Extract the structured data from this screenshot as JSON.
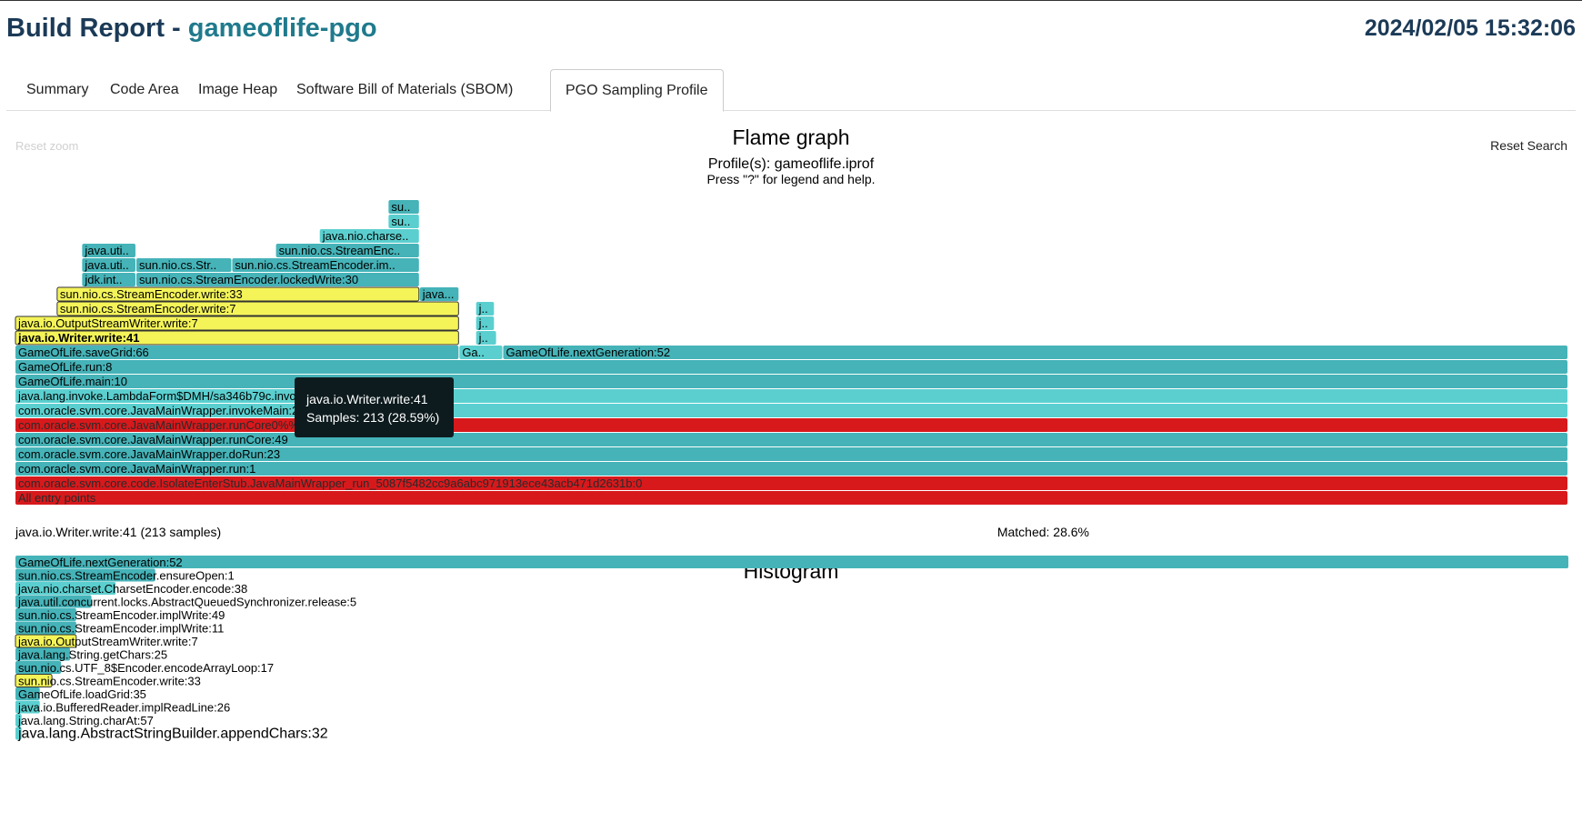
{
  "header": {
    "title_prefix": "Build Report - ",
    "project": "gameoflife-pgo",
    "datetime": "2024/02/05 15:32:06"
  },
  "tabs": [
    {
      "label": "Summary",
      "active": false
    },
    {
      "label": "Code Area",
      "active": false
    },
    {
      "label": "Image Heap",
      "active": false
    },
    {
      "label": "Software Bill of Materials (SBOM)",
      "active": false
    },
    {
      "label": "PGO Sampling Profile",
      "active": true
    }
  ],
  "flame": {
    "title": "Flame graph",
    "subtitle": "Profile(s): gameoflife.iprof",
    "help": "Press \"?\" for legend and help.",
    "reset_zoom": "Reset zoom",
    "reset_search": "Reset Search",
    "details": "java.io.Writer.write:41 (213 samples)",
    "matched": "Matched: 28.6%",
    "tooltip": {
      "name": "java.io.Writer.write:41",
      "samples": "Samples: 213 (28.59%)"
    }
  },
  "chart_data": {
    "type": "flame",
    "total_samples": 745,
    "frames": [
      {
        "name": "All entry points",
        "depth": 0,
        "start": 0,
        "samples": 745,
        "color": "#d7191c"
      },
      {
        "name": "com.oracle.svm.core.code.IsolateEnterStub.JavaMainWrapper_run_5087f5482cc9a6abc971913ece43acb471d2631b:0",
        "depth": 1,
        "start": 0,
        "samples": 745,
        "color": "#d7191c"
      },
      {
        "name": "com.oracle.svm.core.JavaMainWrapper.run:1",
        "depth": 2,
        "start": 0,
        "samples": 745,
        "color": "#45b3b8"
      },
      {
        "name": "com.oracle.svm.core.JavaMainWrapper.doRun:23",
        "depth": 3,
        "start": 0,
        "samples": 745,
        "color": "#45b3b8"
      },
      {
        "name": "com.oracle.svm.core.JavaMainWrapper.runCore:49",
        "depth": 4,
        "start": 0,
        "samples": 745,
        "color": "#45b3b8"
      },
      {
        "name": "com.oracle.svm.core.JavaMainWrapper.runCore0%%Host_Method_Key_0:0",
        "depth": 5,
        "start": 0,
        "samples": 745,
        "color": "#d7191c"
      },
      {
        "name": "com.oracle.svm.core.JavaMainWrapper.invokeMain:29",
        "depth": 6,
        "start": 0,
        "samples": 745,
        "color": "#5bcfcf"
      },
      {
        "name": "java.lang.invoke.LambdaForm$DMH/sa346b79c.invokeStatic:0",
        "depth": 7,
        "start": 0,
        "samples": 745,
        "color": "#5bcfcf"
      },
      {
        "name": "GameOfLife.main:10",
        "depth": 8,
        "start": 0,
        "samples": 745,
        "color": "#45b3b8"
      },
      {
        "name": "GameOfLife.run:8",
        "depth": 9,
        "start": 0,
        "samples": 745,
        "color": "#45b3b8"
      },
      {
        "name": "GameOfLife.saveGrid:66",
        "depth": 10,
        "start": 0,
        "samples": 213,
        "color": "#45b3b8"
      },
      {
        "name": "GameOfLife.saveGrid:70",
        "depth": 10,
        "start": 213,
        "samples": 21,
        "color": "#5bcfcf",
        "label": "Ga.."
      },
      {
        "name": "GameOfLife.nextGeneration:52",
        "depth": 10,
        "start": 234,
        "samples": 511,
        "color": "#45b3b8"
      },
      {
        "name": "java.io.Writer.write:41",
        "depth": 11,
        "start": 0,
        "samples": 213,
        "color": "#f4f459",
        "highlight": true
      },
      {
        "name": "java.io.BufferedWriter.write",
        "depth": 11,
        "start": 221,
        "samples": 10,
        "color": "#5bcfcf",
        "label": "j.."
      },
      {
        "name": "java.io.OutputStreamWriter.write:7",
        "depth": 12,
        "start": 0,
        "samples": 213,
        "color": "#f4f459",
        "highlight": true
      },
      {
        "name": "java.io.BufferedWriter.flushBuffer",
        "depth": 12,
        "start": 221,
        "samples": 9,
        "color": "#5bcfcf",
        "label": "j.."
      },
      {
        "name": "sun.nio.cs.StreamEncoder.write:7",
        "depth": 13,
        "start": 20,
        "samples": 193,
        "color": "#f4f459",
        "highlight": true
      },
      {
        "name": "java.io.Writer.write",
        "depth": 13,
        "start": 221,
        "samples": 9,
        "color": "#5bcfcf",
        "label": "j.."
      },
      {
        "name": "sun.nio.cs.StreamEncoder.write:33",
        "depth": 14,
        "start": 20,
        "samples": 174,
        "color": "#f4f459",
        "highlight": true
      },
      {
        "name": "java.nio.CharBuffer.wrap",
        "depth": 14,
        "start": 194,
        "samples": 19,
        "color": "#45b3b8",
        "label": "java..."
      },
      {
        "name": "jdk.internal.misc.Unsafe",
        "depth": 15,
        "start": 32,
        "samples": 26,
        "color": "#45b3b8",
        "label": "jdk.int.."
      },
      {
        "name": "sun.nio.cs.StreamEncoder.lockedWrite:30",
        "depth": 15,
        "start": 58,
        "samples": 136,
        "color": "#45b3b8"
      },
      {
        "name": "java.util.concurrent.locks",
        "depth": 16,
        "start": 32,
        "samples": 26,
        "color": "#45b3b8",
        "label": "java.uti.."
      },
      {
        "name": "sun.nio.cs.StreamEncoder.implWrite:11",
        "depth": 16,
        "start": 58,
        "samples": 46,
        "color": "#45b3b8",
        "label": "sun.nio.cs.Str.."
      },
      {
        "name": "sun.nio.cs.StreamEncoder.implWrite:49",
        "depth": 16,
        "start": 104,
        "samples": 90,
        "color": "#45b3b8",
        "label": "sun.nio.cs.StreamEncoder.im.."
      },
      {
        "name": "java.util.concurrent.locks.AbstractQueuedSynchronizer.release:5",
        "depth": 17,
        "start": 32,
        "samples": 26,
        "color": "#45b3b8",
        "label": "java.uti.."
      },
      {
        "name": "sun.nio.cs.StreamEncoder.flushLeftoverChar",
        "depth": 17,
        "start": 125,
        "samples": 69,
        "color": "#45b3b8",
        "label": "sun.nio.cs.StreamEnc.."
      },
      {
        "name": "java.nio.charset.CharsetEncoder.encode:38",
        "depth": 18,
        "start": 146,
        "samples": 48,
        "color": "#5bcfcf",
        "label": "java.nio.charse.."
      },
      {
        "name": "sun.nio.cs.UTF_8$Encoder.encodeLoop",
        "depth": 19,
        "start": 179,
        "samples": 15,
        "color": "#5bcfcf",
        "label": "su.."
      },
      {
        "name": "sun.nio.cs.UTF_8$Encoder.encodeArrayLoop:17",
        "depth": 20,
        "start": 179,
        "samples": 15,
        "color": "#45b3b8",
        "label": "su.."
      }
    ],
    "histogram": [
      {
        "name": "GameOfLife.nextGeneration:52",
        "samples": 511,
        "color": "#45b3b8"
      },
      {
        "name": "sun.nio.cs.StreamEncoder.ensureOpen:1",
        "samples": 46,
        "color": "#45b3b8"
      },
      {
        "name": "java.nio.charset.CharsetEncoder.encode:38",
        "samples": 33,
        "color": "#5bcfcf"
      },
      {
        "name": "java.util.concurrent.locks.AbstractQueuedSynchronizer.release:5",
        "samples": 25,
        "color": "#45b3b8"
      },
      {
        "name": "sun.nio.cs.StreamEncoder.implWrite:49",
        "samples": 20,
        "color": "#45b3b8"
      },
      {
        "name": "sun.nio.cs.StreamEncoder.implWrite:11",
        "samples": 20,
        "color": "#45b3b8"
      },
      {
        "name": "java.io.OutputStreamWriter.write:7",
        "samples": 20,
        "color": "#f4f459",
        "highlight": true
      },
      {
        "name": "java.lang.String.getChars:25",
        "samples": 18,
        "color": "#45b3b8"
      },
      {
        "name": "sun.nio.cs.UTF_8$Encoder.encodeArrayLoop:17",
        "samples": 15,
        "color": "#45b3b8"
      },
      {
        "name": "sun.nio.cs.StreamEncoder.write:33",
        "samples": 12,
        "color": "#f4f459",
        "highlight": true
      },
      {
        "name": "GameOfLife.loadGrid:35",
        "samples": 8,
        "color": "#45b3b8"
      },
      {
        "name": "java.io.BufferedReader.implReadLine:26",
        "samples": 8,
        "color": "#5bcfcf"
      },
      {
        "name": "java.lang.String.charAt:57",
        "samples": 2,
        "color": "#5bcfcf"
      },
      {
        "name": "java.lang.AbstractStringBuilder.appendChars:32",
        "samples": 2,
        "color": "#5bcfcf"
      }
    ]
  },
  "histogram_title": "Histogram"
}
